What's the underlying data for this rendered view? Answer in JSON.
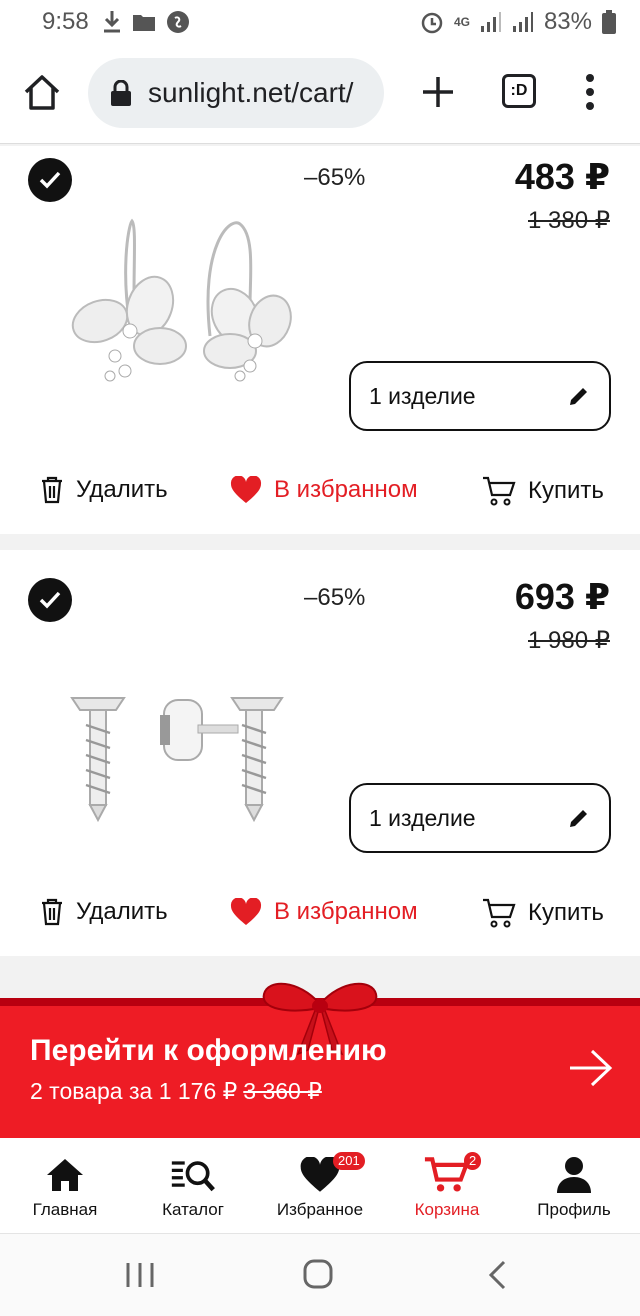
{
  "status_bar": {
    "time": "9:58",
    "battery": "83%",
    "network": "4G"
  },
  "browser": {
    "url": "sunlight.net/cart/",
    "tabs_label": ":D"
  },
  "cart_items": [
    {
      "discount": "–65%",
      "price": "483 ₽",
      "old_price": "1 380 ₽",
      "quantity": "1 изделие",
      "delete_label": "Удалить",
      "favorite_label": "В избранном",
      "buy_label": "Купить"
    },
    {
      "discount": "–65%",
      "price": "693 ₽",
      "old_price": "1 980 ₽",
      "quantity": "1 изделие",
      "delete_label": "Удалить",
      "favorite_label": "В избранном",
      "buy_label": "Купить"
    }
  ],
  "checkout": {
    "title": "Перейти к оформлению",
    "summary": "2 товара за 1 176 ₽",
    "old_total": "3 360 ₽"
  },
  "bottom_nav": {
    "items": [
      {
        "label": "Главная",
        "icon": "home-icon"
      },
      {
        "label": "Каталог",
        "icon": "catalog-search-icon"
      },
      {
        "label": "Избранное",
        "icon": "heart-icon",
        "badge": "201"
      },
      {
        "label": "Корзина",
        "icon": "cart-icon",
        "badge": "2",
        "active": true
      },
      {
        "label": "Профиль",
        "icon": "profile-icon"
      }
    ]
  },
  "colors": {
    "brand_red": "#ee1c25",
    "text": "#111111"
  }
}
